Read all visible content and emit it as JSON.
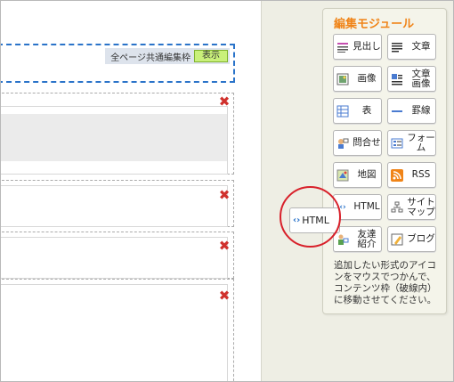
{
  "common_frame": {
    "label": "全ページ共通編集枠",
    "show_button": "表示"
  },
  "content_blocks": [
    {
      "close_label": "✖"
    },
    {
      "close_label": "✖"
    },
    {
      "close_label": "✖"
    },
    {
      "close_label": "✖"
    }
  ],
  "module_panel": {
    "title": "編集モジュール",
    "buttons": [
      {
        "label": "見出し",
        "icon": "heading-icon"
      },
      {
        "label": "文章",
        "icon": "text-icon"
      },
      {
        "label": "画像",
        "icon": "image-icon"
      },
      {
        "label": "文章\n画像",
        "icon": "text-image-icon"
      },
      {
        "label": "表",
        "icon": "table-icon"
      },
      {
        "label": "罫線",
        "icon": "rule-line-icon"
      },
      {
        "label": "問合せ",
        "icon": "contact-icon"
      },
      {
        "label": "フォーム",
        "icon": "form-icon"
      },
      {
        "label": "地図",
        "icon": "map-icon"
      },
      {
        "label": "RSS",
        "icon": "rss-icon"
      },
      {
        "label": "HTML",
        "icon": "html-icon"
      },
      {
        "label": "サイト\nマップ",
        "icon": "sitemap-icon"
      },
      {
        "label": "友達\n紹介",
        "icon": "friend-referral-icon"
      },
      {
        "label": "ブログ",
        "icon": "blog-icon"
      }
    ],
    "help_text": "追加したい形式のアイコンをマウスでつかんで、コンテンツ枠（破線内）に移動させてください。"
  },
  "drag_ghost": {
    "label": "HTML",
    "icon": "html-icon"
  },
  "colors": {
    "accent_orange": "#f08418",
    "dashed_blue": "#2a73c9",
    "close_red": "#d0312d",
    "show_green": "#c9f07a",
    "highlight_red": "#d8202a"
  }
}
